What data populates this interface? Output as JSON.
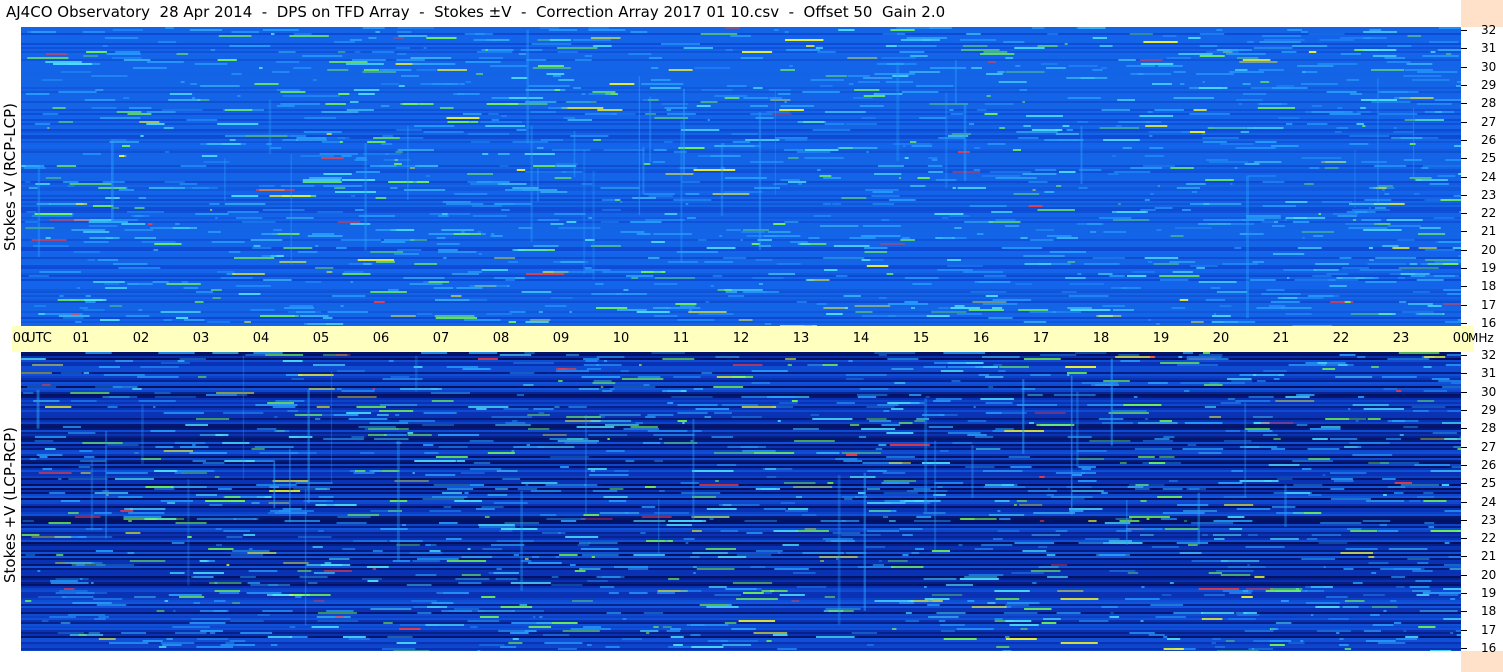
{
  "title": "AJ4CO Observatory  28 Apr 2014  -  DPS on TFD Array  -  Stokes ±V  -  Correction Array 2017 01 10.csv  -  Offset 50  Gain 2.0",
  "chart_data": [
    {
      "type": "heatmap",
      "panel": "top",
      "ylabel": "Stokes -V (RCP-LCP)",
      "x_ticks": [
        "00",
        "UTC",
        "01",
        "02",
        "03",
        "04",
        "05",
        "06",
        "07",
        "08",
        "09",
        "10",
        "11",
        "12",
        "13",
        "14",
        "15",
        "16",
        "17",
        "18",
        "19",
        "20",
        "21",
        "22",
        "23",
        "00"
      ],
      "x_unit_label": "UTC",
      "y_ticks": [
        "32",
        "31",
        "30",
        "29",
        "28",
        "27",
        "26",
        "25",
        "24",
        "23",
        "22",
        "21",
        "20",
        "19",
        "18",
        "17",
        "16"
      ],
      "y_range": [
        16,
        32
      ],
      "x_range": [
        0,
        24
      ],
      "colormap": [
        "#000033",
        "#0a1e8c",
        "#0a3cc8",
        "#1464f0",
        "#28a0ff",
        "#50e6ff",
        "#78ff50",
        "#ffff28",
        "#ff3c3c"
      ]
    },
    {
      "type": "heatmap",
      "panel": "bottom",
      "ylabel": "Stokes +V (LCP-RCP)",
      "y_ticks": [
        "32",
        "31",
        "30",
        "29",
        "28",
        "27",
        "26",
        "25",
        "24",
        "23",
        "22",
        "21",
        "20",
        "19",
        "18",
        "17",
        "16"
      ],
      "y_range": [
        16,
        32
      ],
      "x_range": [
        0,
        24
      ],
      "unit": "MHz"
    }
  ],
  "axis": {
    "utc_label": "UTC",
    "mhz_label": "MHz",
    "hour_labels": [
      "00",
      "01",
      "02",
      "03",
      "04",
      "05",
      "06",
      "07",
      "08",
      "09",
      "10",
      "11",
      "12",
      "13",
      "14",
      "15",
      "16",
      "17",
      "18",
      "19",
      "20",
      "21",
      "22",
      "23",
      "00"
    ]
  },
  "colors": {
    "time_axis_bg": "#ffffc0",
    "freq_band_bg": "#ffe0c8",
    "spectrogram_base_top": "#1464e6",
    "spectrogram_base_bottom": "#0a32b4"
  }
}
